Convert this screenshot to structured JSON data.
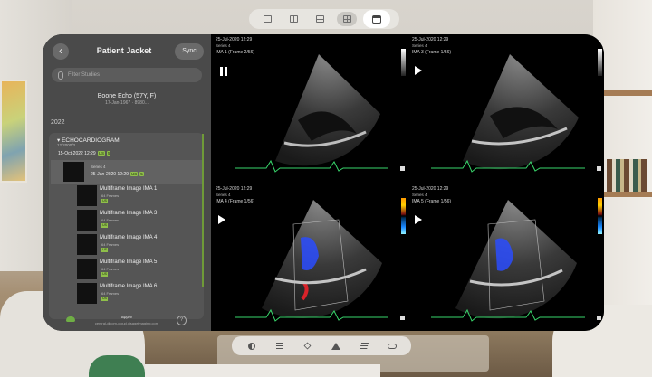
{
  "top_toolbar": {
    "buttons": [
      "single-layout",
      "split-layout",
      "horizontal-split-layout",
      "grid-layout",
      "calendar"
    ],
    "selected": "grid-layout"
  },
  "sidebar": {
    "title": "Patient Jacket",
    "sync_label": "Sync",
    "search_placeholder": "Filter Studies",
    "patient_name": "Boone Echo (57Y, F)",
    "patient_dob": "17-Jan-1967 · 8980...",
    "year": "2022",
    "study": {
      "title": "ECHOCARDIOGRAM",
      "subtitle": "12/2000/3",
      "date": "15-Oct-2022 12:29",
      "tags": [
        "US",
        "5"
      ]
    },
    "series": {
      "name": "Series 4",
      "date": "25-Jan-2020 12:29",
      "tags": [
        "US",
        "5"
      ]
    },
    "images": [
      {
        "name": "Multiframe Image IMA 1",
        "frames": "64 Frames",
        "tag": "US"
      },
      {
        "name": "Multiframe Image IMA 3",
        "frames": "64 Frames",
        "tag": "US"
      },
      {
        "name": "Multiframe Image IMA 4",
        "frames": "64 Frames",
        "tag": "US"
      },
      {
        "name": "Multiframe Image IMA 5",
        "frames": "64 Frames",
        "tag": "US"
      },
      {
        "name": "Multiframe Image IMA 6",
        "frames": "64 Frames",
        "tag": "US"
      }
    ],
    "footer_name": "apple",
    "footer_url": "central-dicom-cloud.visageimaging.com"
  },
  "viewports": [
    {
      "date": "25-Jul-2020 12:29",
      "series": "Series 4",
      "ima": "IMA 1 (Frame 2/56)",
      "control": "pause",
      "doppler": false
    },
    {
      "date": "25-Jul-2020 12:29",
      "series": "Series 4",
      "ima": "IMA 3 (Frame 1/56)",
      "control": "play",
      "doppler": false
    },
    {
      "date": "25-Jul-2020 12:29",
      "series": "Series 4",
      "ima": "IMA 4 (Frame 1/56)",
      "control": "play",
      "doppler": true
    },
    {
      "date": "25-Jul-2020 12:29",
      "series": "Series 4",
      "ima": "IMA 5 (Frame 1/56)",
      "control": "play",
      "doppler": true
    }
  ],
  "bottom_toolbar": {
    "buttons": [
      "contrast",
      "list",
      "3d-cube",
      "measure",
      "layers",
      "vr-headset"
    ]
  },
  "colors": {
    "accent_green": "#8fbf4a",
    "sidebar_bg": "#4a4a4a",
    "viewport_bg": "#000000",
    "ecg_trace": "#38d66b",
    "doppler_red": "#d9232a",
    "doppler_blue": "#2a4cff"
  }
}
